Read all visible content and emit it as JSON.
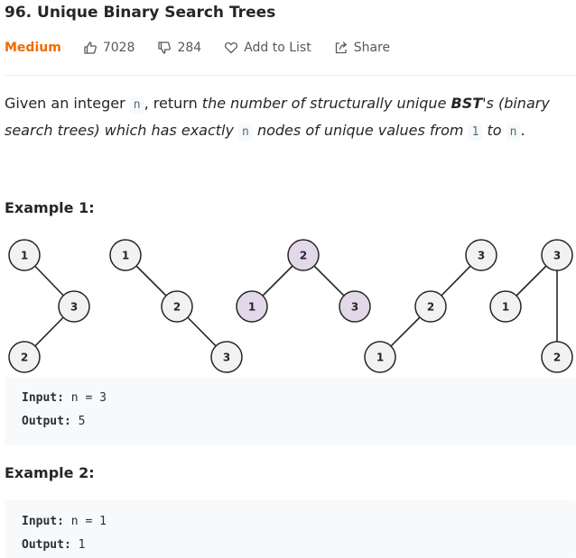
{
  "problem": {
    "title": "96. Unique Binary Search Trees",
    "difficulty": "Medium",
    "likes": "7028",
    "dislikes": "284",
    "add_to_list": "Add to List",
    "share": "Share",
    "accent_color": "#ef6c00"
  },
  "description": {
    "t1": "Given an integer ",
    "c1": "n",
    "t2": ", return ",
    "i1": "the number of structurally unique ",
    "b1": "BST",
    "i2": "'s (binary search trees) which has exactly ",
    "c2": "n",
    "i3": " nodes of unique values from ",
    "c3": "1",
    "i4": " to ",
    "c4": "n",
    "t3": "."
  },
  "example1": {
    "heading": "Example 1:",
    "input_label": "Input:",
    "input_value": " n = 3",
    "output_label": "Output:",
    "output_value": " 5"
  },
  "example2": {
    "heading": "Example 2:",
    "input_label": "Input:",
    "input_value": " n = 1",
    "output_label": "Output:",
    "output_value": " 1"
  },
  "trees": {
    "node_fill": "#f2f2f2",
    "highlight_fill": "#e3d7ea",
    "nodes": [
      {
        "label": "1",
        "highlight": false
      },
      {
        "label": "3",
        "highlight": false
      },
      {
        "label": "2",
        "highlight": false
      },
      {
        "label": "1",
        "highlight": false
      },
      {
        "label": "2",
        "highlight": false
      },
      {
        "label": "3",
        "highlight": false
      },
      {
        "label": "2",
        "highlight": true
      },
      {
        "label": "1",
        "highlight": true
      },
      {
        "label": "3",
        "highlight": true
      },
      {
        "label": "3",
        "highlight": false
      },
      {
        "label": "2",
        "highlight": false
      },
      {
        "label": "1",
        "highlight": false
      },
      {
        "label": "3",
        "highlight": false
      },
      {
        "label": "1",
        "highlight": false
      },
      {
        "label": "2",
        "highlight": false
      }
    ]
  }
}
